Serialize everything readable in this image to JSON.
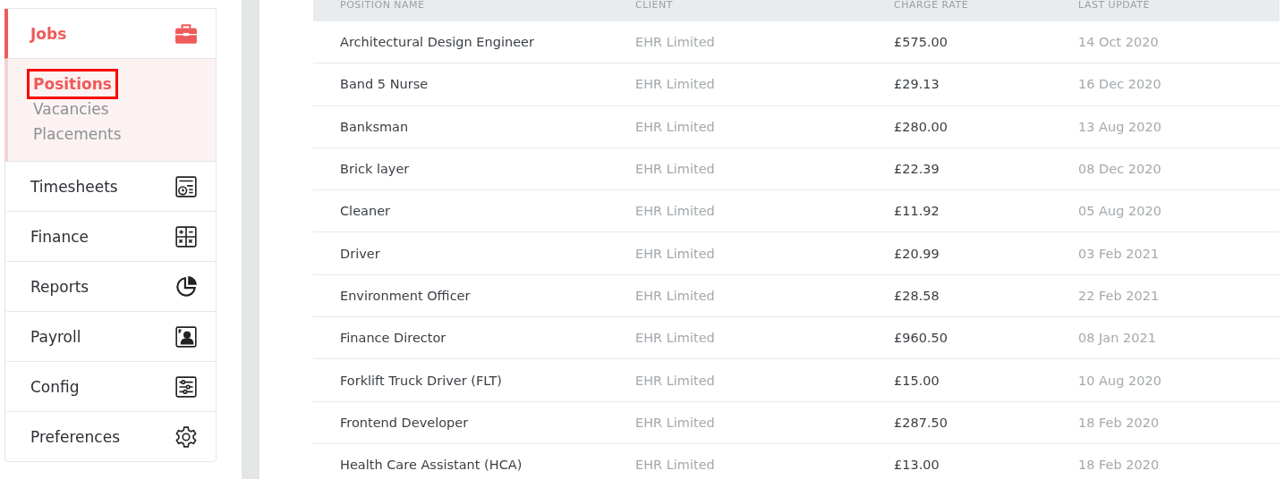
{
  "sidebar": {
    "items": [
      {
        "label": "Jobs",
        "selected": true,
        "children": [
          {
            "label": "Positions",
            "selected": true
          },
          {
            "label": "Vacancies",
            "selected": false
          },
          {
            "label": "Placements",
            "selected": false
          }
        ]
      },
      {
        "label": "Timesheets",
        "selected": false
      },
      {
        "label": "Finance",
        "selected": false
      },
      {
        "label": "Reports",
        "selected": false
      },
      {
        "label": "Payroll",
        "selected": false
      },
      {
        "label": "Config",
        "selected": false
      },
      {
        "label": "Preferences",
        "selected": false
      }
    ]
  },
  "table": {
    "columns": [
      "POSITION NAME",
      "CLIENT",
      "CHARGE RATE",
      "LAST UPDATE"
    ],
    "rows": [
      [
        "Architectural Design Engineer",
        "EHR Limited",
        "£575.00",
        "14 Oct 2020"
      ],
      [
        "Band 5 Nurse",
        "EHR Limited",
        "£29.13",
        "16 Dec 2020"
      ],
      [
        "Banksman",
        "EHR Limited",
        "£280.00",
        "13 Aug 2020"
      ],
      [
        "Brick layer",
        "EHR Limited",
        "£22.39",
        "08 Dec 2020"
      ],
      [
        "Cleaner",
        "EHR Limited",
        "£11.92",
        "05 Aug 2020"
      ],
      [
        "Driver",
        "EHR Limited",
        "£20.99",
        "03 Feb 2021"
      ],
      [
        "Environment Officer",
        "EHR Limited",
        "£28.58",
        "22 Feb 2021"
      ],
      [
        "Finance Director",
        "EHR Limited",
        "£960.50",
        "08 Jan 2021"
      ],
      [
        "Forklift Truck Driver (FLT)",
        "EHR Limited",
        "£15.00",
        "10 Aug 2020"
      ],
      [
        "Frontend Developer",
        "EHR Limited",
        "£287.50",
        "18 Feb 2020"
      ],
      [
        "Health Care Assistant (HCA)",
        "EHR Limited",
        "£13.00",
        "18 Feb 2020"
      ]
    ]
  }
}
